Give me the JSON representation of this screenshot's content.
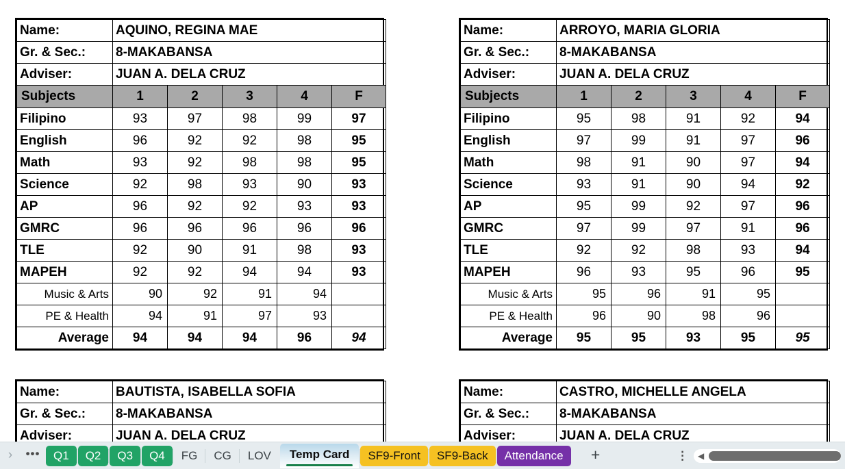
{
  "labels": {
    "name": "Name:",
    "grade_section": "Gr. & Sec.:",
    "adviser": "Adviser:",
    "subjects_header": "Subjects",
    "average": "Average"
  },
  "quarter_headers": [
    "1",
    "2",
    "3",
    "4",
    "F"
  ],
  "cards": [
    {
      "name": "AQUINO, REGINA MAE",
      "grade_section": "8-MAKABANSA",
      "adviser": "JUAN A. DELA CRUZ",
      "rows": [
        {
          "subject": "Filipino",
          "q1": "93",
          "q2": "97",
          "q3": "98",
          "q4": "99",
          "f": "97"
        },
        {
          "subject": "English",
          "q1": "96",
          "q2": "92",
          "q3": "92",
          "q4": "98",
          "f": "95"
        },
        {
          "subject": "Math",
          "q1": "93",
          "q2": "92",
          "q3": "98",
          "q4": "98",
          "f": "95"
        },
        {
          "subject": "Science",
          "q1": "92",
          "q2": "98",
          "q3": "93",
          "q4": "90",
          "f": "93"
        },
        {
          "subject": "AP",
          "q1": "96",
          "q2": "92",
          "q3": "92",
          "q4": "93",
          "f": "93"
        },
        {
          "subject": "GMRC",
          "q1": "96",
          "q2": "96",
          "q3": "96",
          "q4": "96",
          "f": "96"
        },
        {
          "subject": "TLE",
          "q1": "92",
          "q2": "90",
          "q3": "91",
          "q4": "98",
          "f": "93"
        },
        {
          "subject": "MAPEH",
          "q1": "92",
          "q2": "92",
          "q3": "94",
          "q4": "94",
          "f": "93"
        }
      ],
      "sub_rows": [
        {
          "subject": "Music & Arts",
          "q1": "90",
          "q2": "92",
          "q3": "91",
          "q4": "94",
          "f": ""
        },
        {
          "subject": "PE & Health",
          "q1": "94",
          "q2": "91",
          "q3": "97",
          "q4": "93",
          "f": ""
        }
      ],
      "average": {
        "q1": "94",
        "q2": "94",
        "q3": "94",
        "q4": "96",
        "f": "94"
      },
      "truncated": false
    },
    {
      "name": "ARROYO, MARIA GLORIA",
      "grade_section": "8-MAKABANSA",
      "adviser": "JUAN A. DELA CRUZ",
      "rows": [
        {
          "subject": "Filipino",
          "q1": "95",
          "q2": "98",
          "q3": "91",
          "q4": "92",
          "f": "94"
        },
        {
          "subject": "English",
          "q1": "97",
          "q2": "99",
          "q3": "91",
          "q4": "97",
          "f": "96"
        },
        {
          "subject": "Math",
          "q1": "98",
          "q2": "91",
          "q3": "90",
          "q4": "97",
          "f": "94"
        },
        {
          "subject": "Science",
          "q1": "93",
          "q2": "91",
          "q3": "90",
          "q4": "94",
          "f": "92"
        },
        {
          "subject": "AP",
          "q1": "95",
          "q2": "99",
          "q3": "92",
          "q4": "97",
          "f": "96"
        },
        {
          "subject": "GMRC",
          "q1": "97",
          "q2": "99",
          "q3": "97",
          "q4": "91",
          "f": "96"
        },
        {
          "subject": "TLE",
          "q1": "92",
          "q2": "92",
          "q3": "98",
          "q4": "93",
          "f": "94"
        },
        {
          "subject": "MAPEH",
          "q1": "96",
          "q2": "93",
          "q3": "95",
          "q4": "96",
          "f": "95"
        }
      ],
      "sub_rows": [
        {
          "subject": "Music & Arts",
          "q1": "95",
          "q2": "96",
          "q3": "91",
          "q4": "95",
          "f": ""
        },
        {
          "subject": "PE & Health",
          "q1": "96",
          "q2": "90",
          "q3": "98",
          "q4": "96",
          "f": ""
        }
      ],
      "average": {
        "q1": "95",
        "q2": "95",
        "q3": "93",
        "q4": "95",
        "f": "95"
      },
      "truncated": false
    },
    {
      "name": "BAUTISTA, ISABELLA SOFIA",
      "grade_section": "8-MAKABANSA",
      "adviser": "JUAN A. DELA CRUZ",
      "rows": [],
      "sub_rows": [],
      "average": {
        "q1": "",
        "q2": "",
        "q3": "",
        "q4": "",
        "f": ""
      },
      "truncated": true
    },
    {
      "name": "CASTRO, MICHELLE ANGELA",
      "grade_section": "8-MAKABANSA",
      "adviser": "JUAN A. DELA CRUZ",
      "rows": [],
      "sub_rows": [],
      "average": {
        "q1": "",
        "q2": "",
        "q3": "",
        "q4": "",
        "f": ""
      },
      "truncated": true
    }
  ],
  "tabbar": {
    "nav_chevron": "›",
    "overflow_dots": "•••",
    "tabs": [
      {
        "label": "Q1",
        "style": "green",
        "active": false
      },
      {
        "label": "Q2",
        "style": "green",
        "active": false
      },
      {
        "label": "Q3",
        "style": "green",
        "active": false
      },
      {
        "label": "Q4",
        "style": "green",
        "active": false
      },
      {
        "label": "FG",
        "style": "plain",
        "active": false
      },
      {
        "label": "CG",
        "style": "plain",
        "active": false
      },
      {
        "label": "LOV",
        "style": "plain",
        "active": false
      },
      {
        "label": "Temp Card",
        "style": "plain",
        "active": true
      },
      {
        "label": "SF9-Front",
        "style": "amber",
        "active": false
      },
      {
        "label": "SF9-Back",
        "style": "amber",
        "active": false
      },
      {
        "label": "Attendance",
        "style": "purple",
        "active": false
      }
    ],
    "add_sheet": "+",
    "tab_menu": "⋮",
    "scroll_left_arrow": "◀"
  },
  "colors": {
    "green_tab": "#21a366",
    "amber_tab": "#f5c122",
    "purple_tab": "#7530a8",
    "header_gray": "#a9a9a9",
    "active_underline": "#187f4a",
    "tabbar_bg": "#e6ecef"
  }
}
